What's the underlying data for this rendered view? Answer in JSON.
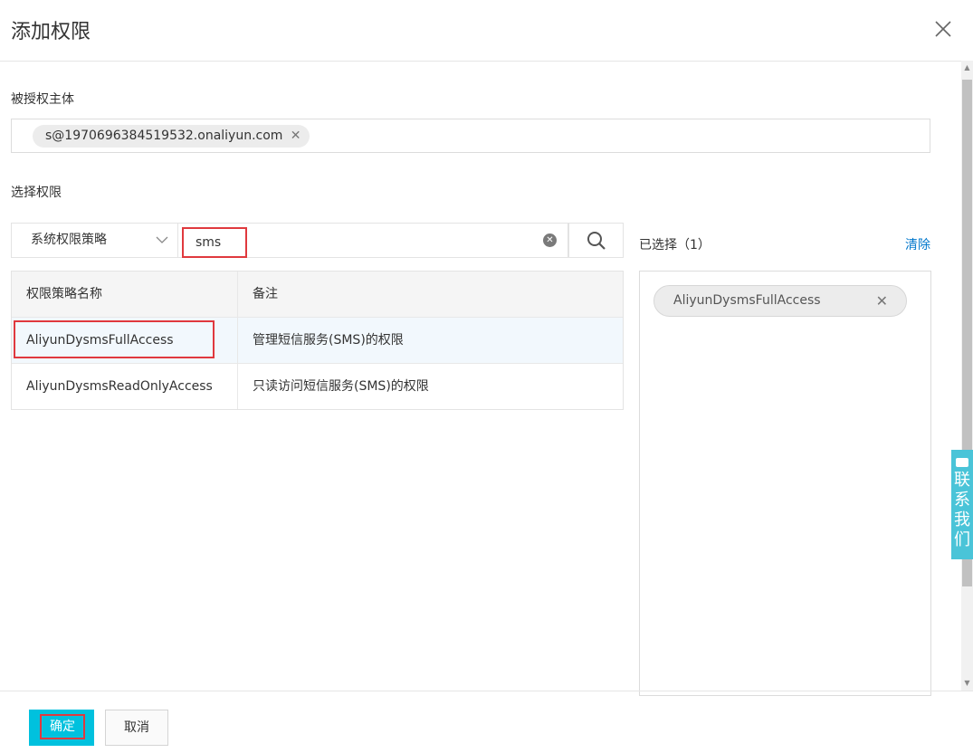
{
  "dialog": {
    "title": "添加权限"
  },
  "principal": {
    "label": "被授权主体",
    "tag": "s@1970696384519532.onaliyun.com"
  },
  "permissions": {
    "label": "选择权限",
    "type_select": "系统权限策略",
    "search_value": "sms",
    "columns": [
      "权限策略名称",
      "备注"
    ],
    "rows": [
      {
        "name": "AliyunDysmsFullAccess",
        "note": "管理短信服务(SMS)的权限",
        "selected": true
      },
      {
        "name": "AliyunDysmsReadOnlyAccess",
        "note": "只读访问短信服务(SMS)的权限",
        "selected": false
      }
    ]
  },
  "selected_panel": {
    "title": "已选择（1）",
    "clear_label": "清除",
    "items": [
      "AliyunDysmsFullAccess"
    ]
  },
  "contact": {
    "label": "联系我们"
  },
  "footer": {
    "ok_label": "确定",
    "cancel_label": "取消"
  },
  "colors": {
    "primary": "#00c1de",
    "highlight": "#e0393e",
    "link": "#0077cc"
  }
}
